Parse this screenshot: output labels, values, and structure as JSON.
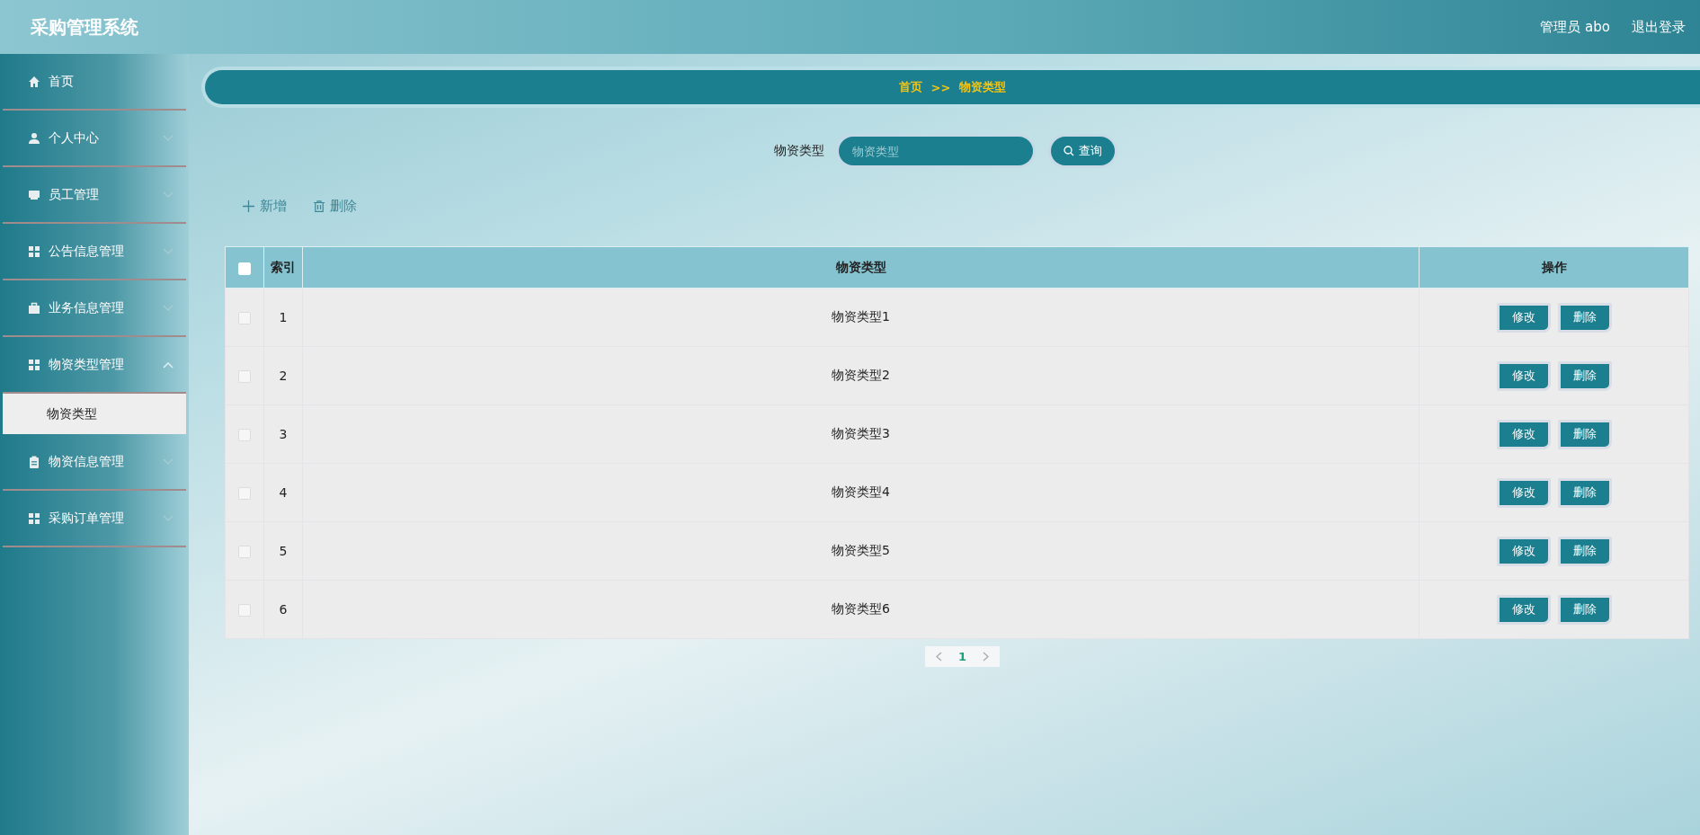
{
  "header": {
    "title": "采购管理系统",
    "user": "管理员 abo",
    "logout": "退出登录"
  },
  "sidebar": {
    "items": [
      {
        "label": "首页"
      },
      {
        "label": "个人中心",
        "expanded": false
      },
      {
        "label": "员工管理",
        "expanded": false
      },
      {
        "label": "公告信息管理",
        "expanded": false
      },
      {
        "label": "业务信息管理",
        "expanded": false
      },
      {
        "label": "物资类型管理",
        "expanded": true,
        "children": [
          {
            "label": "物资类型",
            "selected": true
          }
        ]
      },
      {
        "label": "物资信息管理",
        "expanded": false
      },
      {
        "label": "采购订单管理",
        "expanded": false
      }
    ]
  },
  "breadcrumb": [
    "首页",
    ">>",
    "物资类型"
  ],
  "search": {
    "label": "物资类型",
    "placeholder": "物资类型",
    "button": "查询"
  },
  "actions": [
    {
      "label": "新增",
      "kind": "add"
    },
    {
      "label": "删除",
      "kind": "delete"
    }
  ],
  "table": {
    "select_all_checked": false,
    "columns": [
      "索引",
      "物资类型",
      "操作"
    ],
    "rows": [
      {
        "checked": false,
        "index": "1",
        "type": "物资类型1",
        "buttons": [
          "修改",
          "删除"
        ]
      },
      {
        "checked": false,
        "index": "2",
        "type": "物资类型2",
        "buttons": [
          "修改",
          "删除"
        ]
      },
      {
        "checked": false,
        "index": "3",
        "type": "物资类型3",
        "buttons": [
          "修改",
          "删除"
        ]
      },
      {
        "checked": false,
        "index": "4",
        "type": "物资类型4",
        "buttons": [
          "修改",
          "删除"
        ]
      },
      {
        "checked": false,
        "index": "5",
        "type": "物资类型5",
        "buttons": [
          "修改",
          "删除"
        ]
      },
      {
        "checked": false,
        "index": "6",
        "type": "物资类型6",
        "buttons": [
          "修改",
          "删除"
        ]
      }
    ]
  },
  "pagination": {
    "pages": [
      {
        "label": "1",
        "selected": true
      }
    ]
  }
}
